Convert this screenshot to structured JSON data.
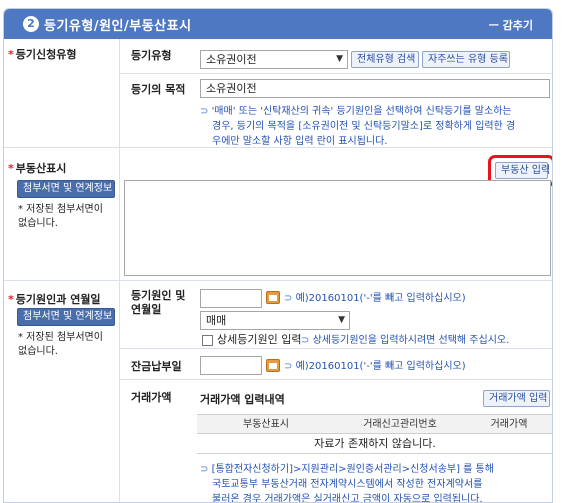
{
  "header": {
    "number": "2",
    "title": "등기유형/원인/부동산표시",
    "collapse": "ㅡ 감추기"
  },
  "section_type": {
    "label": "등기신청유형",
    "type_label": "등기유형",
    "type_value": "소유권이전",
    "btn_search_all": "전체유형 검색",
    "btn_register_freq": "자주쓰는 유형 등록",
    "purpose_label": "등기의 목적",
    "purpose_value": "소유권이전",
    "hint_lines": [
      "'매매' 또는 '신탁재산의 귀속' 등기원인을 선택하여 신탁등기를 말소하는",
      "경우, 등기의 목적을 [소유권이전 및 신탁등기말소]로 정확하게 입력한 경",
      "우에만 말소할 사항 입력 란이 표시됩니다."
    ]
  },
  "section_property": {
    "label": "부동산표시",
    "attach_btn": "첨부서면 및 연계정보",
    "note_lines": [
      "* 저장된 첨부서면이",
      "없습니다."
    ],
    "input_btn": "부동산 입력"
  },
  "section_cause": {
    "label": "등기원인과 연월일",
    "attach_btn": "첨부서면 및 연계정보",
    "note_lines": [
      "* 저장된 첨부서면이",
      "없습니다."
    ],
    "cause_label_lines": [
      "등기원인 및",
      "연월일"
    ],
    "date_value": "",
    "date_hint": "예)20160101('-'를 빼고 입력하십시오)",
    "cause_select": "매매",
    "detail_checkbox": "상세등기원인 입력",
    "detail_hint": "상세등기원인을 입력하시려면 선택해 주십시오.",
    "balance_label": "잔금납부일",
    "balance_value": "",
    "balance_hint": "예)20160101('-'를 빼고 입력하십시오)",
    "trade_label": "거래가액",
    "trade_title": "거래가액 입력내역",
    "trade_btn": "거래가액 입력",
    "table_headers": [
      "부동산표시",
      "거래신고관리번호",
      "거래가액"
    ],
    "empty_text": "자료가 존재하지 않습니다.",
    "info_lines": [
      "[통합전자신청하기]>지원관리>원인증서관리>신청서송부] 를 통해",
      "국토교통부 부동산거래 전자계약시스템에서 작성한 전자계약서를",
      "불러온 경우 거래가액은 실거래신고 금액이 자동으로 입력됩니다."
    ]
  },
  "colors": {
    "header_bg": "#4f78c3",
    "required_mark": "#d8262c",
    "hint_text": "#2452b4",
    "highlight_ring": "#e8141c",
    "calendar": "#e89a3e"
  },
  "icons": {
    "section_number": "numbered-circle-icon",
    "required": "asterisk-icon",
    "hint": "arrow-icon",
    "calendar": "calendar-icon",
    "dropdown": "chevron-down-icon"
  }
}
